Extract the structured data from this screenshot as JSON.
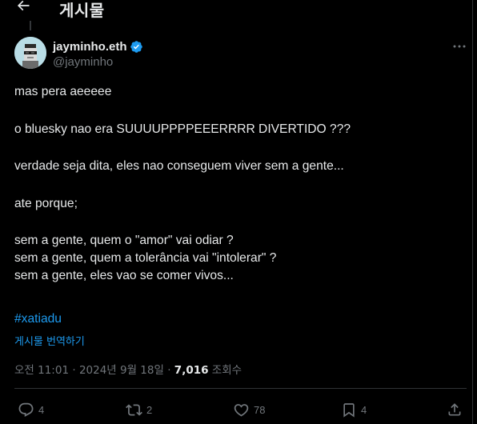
{
  "header": {
    "title": "게시물"
  },
  "author": {
    "display_name": "jayminho.eth",
    "handle": "@jayminho",
    "verified": true
  },
  "post": {
    "lines": [
      "mas pera aeeeee",
      "",
      "o bluesky nao era SUUUUPPPPEEERRRR DIVERTIDO ???",
      "",
      "verdade seja dita, eles nao conseguem viver sem a gente...",
      "",
      "ate porque;",
      "",
      "sem a gente, quem o \"amor\" vai odiar ?",
      "sem a gente, quem a tolerância vai \"intolerar\" ?",
      "sem a gente, eles vao se comer vivos..."
    ],
    "hashtag": "#xatiadu",
    "translate_label": "게시물 번역하기"
  },
  "meta": {
    "time": "오전 11:01",
    "date": "2024년 9월 18일",
    "views_count": "7,016",
    "views_label": "조회수"
  },
  "actions": {
    "replies": "4",
    "reposts": "2",
    "likes": "78",
    "bookmarks": "4"
  },
  "colors": {
    "background": "#000000",
    "text": "#e7e9ea",
    "secondary": "#71767b",
    "accent": "#1d9bf0",
    "border": "#2f3336"
  },
  "icons": [
    "back-arrow-icon",
    "verified-badge-icon",
    "more-icon",
    "reply-icon",
    "repost-icon",
    "like-icon",
    "bookmark-icon",
    "share-icon"
  ]
}
